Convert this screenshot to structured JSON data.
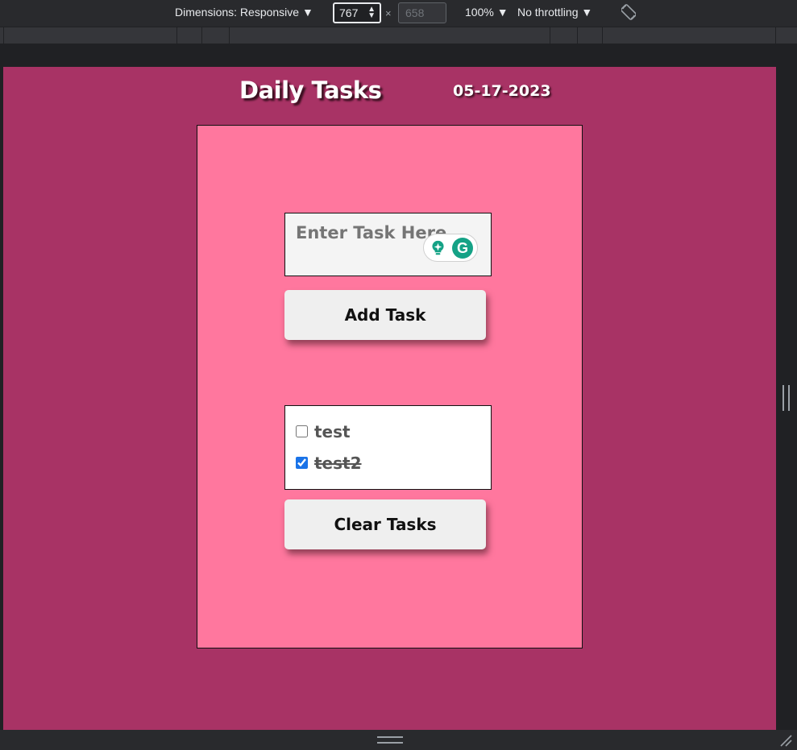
{
  "devtools": {
    "dimensions_label": "Dimensions: Responsive ▼",
    "width_value": "767",
    "times_sign": "×",
    "height_placeholder": "658",
    "zoom_label": "100% ▼",
    "throttle_label": "No throttling ▼",
    "icons": [
      "spin-arrows-icon",
      "rotate-icon",
      "resize-handle-icon",
      "corner-grip-icon"
    ]
  },
  "page": {
    "title": "Daily Tasks",
    "date": "05-17-2023",
    "background_color": "#a83365",
    "card_color": "#ff779e"
  },
  "input": {
    "placeholder": "Enter Task Here"
  },
  "grammarly": {
    "letter": "G",
    "icons": [
      "lightbulb-icon",
      "grammarly-logo-icon"
    ],
    "accent_color": "#15a286"
  },
  "buttons": {
    "add": "Add Task",
    "clear": "Clear Tasks"
  },
  "tasks": [
    {
      "label": "test",
      "checked": false
    },
    {
      "label": "test2",
      "checked": true
    }
  ]
}
